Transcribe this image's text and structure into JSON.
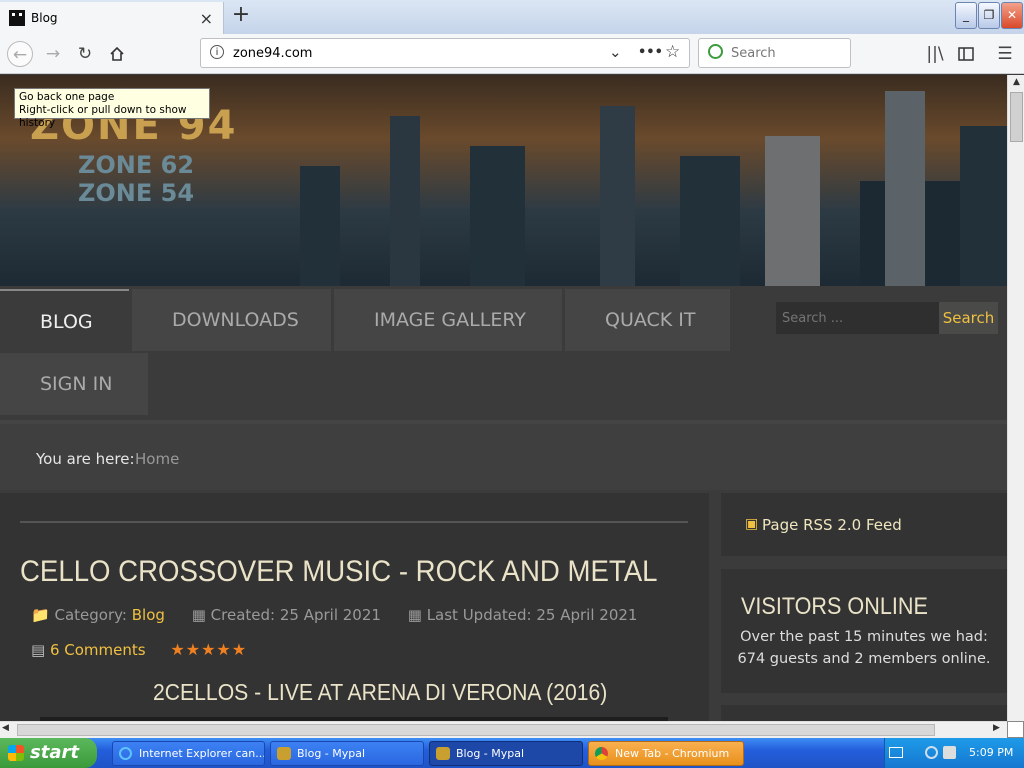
{
  "browser": {
    "tab_title": "Blog",
    "new_tab": "+",
    "close_tab": "×",
    "url": "zone94.com",
    "url_info": "i",
    "page_actions": "•••",
    "search_placeholder": "Search",
    "window_buttons": {
      "minimize": "_",
      "restore": "❐",
      "close": "✕"
    },
    "tooltip_line1": "Go back one page",
    "tooltip_line2": "Right-click or pull down to show history"
  },
  "site": {
    "banner": {
      "zone94": "ZONE 94",
      "zone62": "ZONE 62",
      "zone54": "ZONE 54"
    },
    "menu": [
      {
        "label": "BLOG",
        "active": true
      },
      {
        "label": "DOWNLOADS"
      },
      {
        "label": "IMAGE GALLERY"
      },
      {
        "label": "QUACK IT"
      },
      {
        "label": "SIGN IN"
      }
    ],
    "search": {
      "placeholder": "Search ...",
      "button": "Search"
    },
    "breadcrumb": {
      "prefix": "You are here:",
      "current": "Home"
    },
    "article": {
      "title": "CELLO CROSSOVER MUSIC - ROCK AND METAL",
      "category_label": "Category:",
      "category": "Blog",
      "created": "Created: 25 April 2021",
      "updated": "Last Updated: 25 April 2021",
      "comments": "6 Comments",
      "rating": 5,
      "subtitle": "2CELLOS - LIVE AT ARENA DI VERONA (2016)"
    },
    "sidebar": {
      "rss": "Page RSS 2.0 Feed",
      "visitors_title": "VISITORS ONLINE",
      "visitors_line1": "Over the past 15 minutes we had:",
      "visitors_line2": "674 guests and 2 members online."
    }
  },
  "taskbar": {
    "start": "start",
    "tasks": [
      {
        "label": "Internet Explorer can..."
      },
      {
        "label": "Blog - Mypal"
      },
      {
        "label": "Blog - Mypal"
      },
      {
        "label": "New Tab - Chromium"
      }
    ],
    "clock": "5:09 PM"
  },
  "colors": {
    "accent_gold": "#f0c040",
    "taskbar_blue": "#245edb",
    "start_green": "#3a9a3a"
  }
}
